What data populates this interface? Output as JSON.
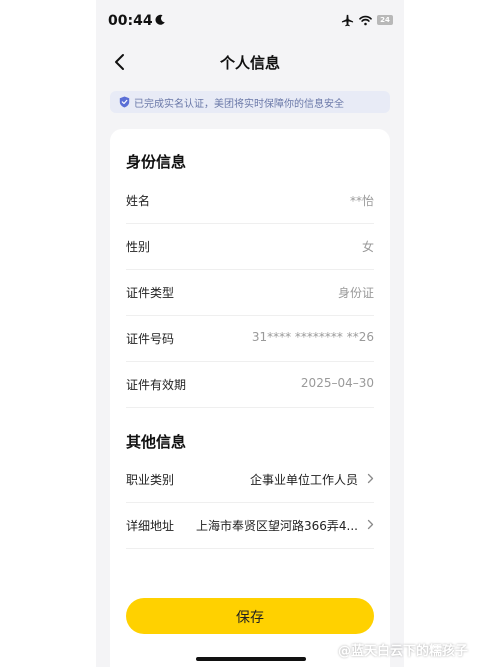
{
  "status_bar": {
    "time": "00:44",
    "battery": "24",
    "icons": [
      "moon-icon",
      "airplane-icon",
      "wifi-icon",
      "battery-icon"
    ]
  },
  "nav": {
    "title": "个人信息",
    "back_icon": "chevron-left-icon"
  },
  "notice": {
    "text": "已完成实名认证，美团将实时保障你的信息安全",
    "icon": "shield-check-icon",
    "color": "#6a78a8"
  },
  "identity": {
    "title": "身份信息",
    "rows": [
      {
        "label": "姓名",
        "value": "**怡"
      },
      {
        "label": "性别",
        "value": "女"
      },
      {
        "label": "证件类型",
        "value": "身份证"
      },
      {
        "label": "证件号码",
        "value": "31**** ******** **26"
      },
      {
        "label": "证件有效期",
        "value": "2025–04–30"
      }
    ]
  },
  "other": {
    "title": "其他信息",
    "rows": [
      {
        "label": "职业类别",
        "value": "企事业单位工作人员"
      },
      {
        "label": "详细地址",
        "value": "上海市奉贤区望河路366弄4..."
      }
    ]
  },
  "actions": {
    "save_label": "保存",
    "accent_color": "#ffd100"
  },
  "watermark": {
    "text": "@蓝天白云下的糯孩子"
  }
}
